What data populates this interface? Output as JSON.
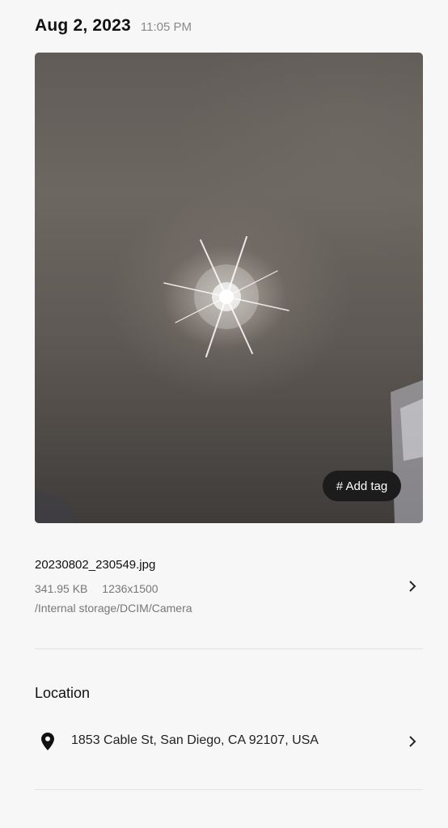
{
  "header": {
    "date": "Aug 2, 2023",
    "time": "11:05 PM"
  },
  "photo": {
    "tag_button_label": "# Add tag"
  },
  "file": {
    "name": "20230802_230549.jpg",
    "size": "341.95 KB",
    "resolution": "1236x1500",
    "path": "/Internal storage/DCIM/Camera"
  },
  "location": {
    "title": "Location",
    "address": "1853 Cable St, San Diego, CA 92107, USA"
  },
  "icons": {
    "location": "map-pin-icon",
    "arrow": "chevron-right-icon"
  }
}
